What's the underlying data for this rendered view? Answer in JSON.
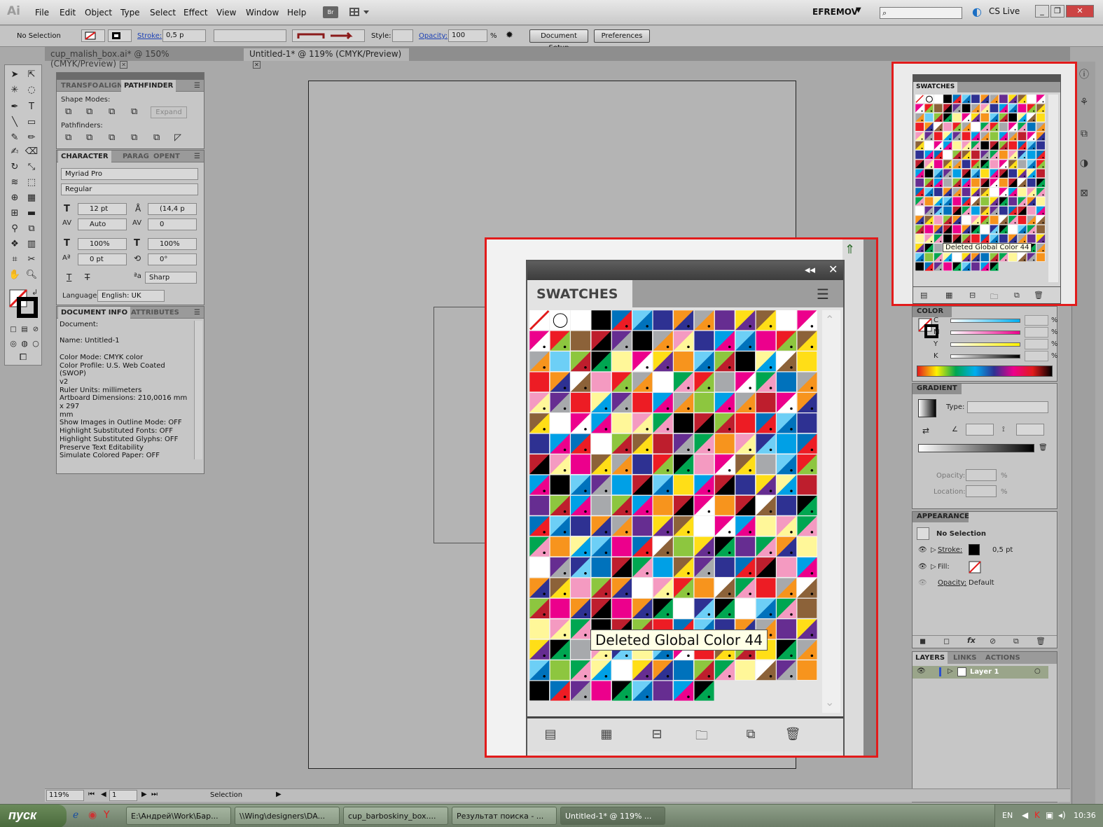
{
  "app": {
    "logo": "Ai",
    "menus": [
      "File",
      "Edit",
      "Object",
      "Type",
      "Select",
      "Effect",
      "View",
      "Window",
      "Help"
    ],
    "bridge_label": "Br",
    "user": "EFREMOV",
    "cs_live": "CS Live",
    "search_placeholder": ""
  },
  "control_bar": {
    "selection": "No Selection",
    "stroke_label": "Stroke:",
    "stroke_weight": "0,5 p",
    "style_label": "Style:",
    "opacity_label": "Opacity:",
    "opacity_value": "100",
    "opacity_unit": "%",
    "document_setup": "Document Setup",
    "preferences": "Preferences"
  },
  "doc_tabs": [
    {
      "label": "cup_malish_box.ai* @ 150% (CMYK/Preview)",
      "active": false
    },
    {
      "label": "Untitled-1* @ 119% (CMYK/Preview)",
      "active": true
    }
  ],
  "pathfinder": {
    "tabs": [
      "TRANSFO",
      "ALIGN",
      "PATHFINDER"
    ],
    "shape_modes": "Shape Modes:",
    "pathfinders": "Pathfinders:",
    "expand": "Expand"
  },
  "character": {
    "tabs": [
      "CHARACTER",
      "PARAG",
      "OPENT"
    ],
    "font": "Myriad Pro",
    "style": "Regular",
    "size": "12 pt",
    "leading": "(14,4 p",
    "kerning": "Auto",
    "tracking": "0",
    "v_scale": "100%",
    "h_scale": "100%",
    "baseline": "0 pt",
    "rotation": "0°",
    "anti_alias": "Sharp",
    "language_label": "Language:",
    "language": "English: UK"
  },
  "document_info": {
    "tabs": [
      "DOCUMENT INFO",
      "ATTRIBUTES"
    ],
    "lines": [
      "Document:",
      "",
      "Name: Untitled-1",
      "",
      "Color Mode: CMYK color",
      "Color Profile: U.S. Web Coated (SWOP)",
      "v2",
      "Ruler Units: millimeters",
      "Artboard Dimensions: 210,0016 mm x 297",
      "mm",
      "Show Images in Outline Mode: OFF",
      "Highlight Substituted Fonts: OFF",
      "Highlight Substituted Glyphs: OFF",
      "Preserve Text Editability",
      "Simulate Colored Paper: OFF"
    ]
  },
  "swatches": {
    "title": "SWATCHES",
    "tooltip": "Deleted Global Color 44",
    "palette": [
      "#000000",
      "#f7941d",
      "#00a0e6",
      "#ed1c24",
      "#ffde17",
      "#00a651",
      "#2e3192",
      "#ec008c",
      "#8dc63f",
      "#662d91",
      "#f49ac1",
      "#6dcff6",
      "#ffffff",
      "#be1e2d",
      "#a7a9ac",
      "#fff799",
      "#0072bc",
      "#8c6239"
    ]
  },
  "color_panel": {
    "title": "COLOR",
    "channels": [
      "C",
      "M",
      "Y",
      "K"
    ],
    "unit": "%"
  },
  "gradient_panel": {
    "title": "GRADIENT",
    "type_label": "Type:",
    "opacity_label": "Opacity:",
    "location_label": "Location:",
    "unit": "%"
  },
  "appearance_panel": {
    "title": "APPEARANCE",
    "selection": "No Selection",
    "stroke_label": "Stroke:",
    "stroke_value": "0,5 pt",
    "fill_label": "Fill:",
    "opacity_label": "Opacity:",
    "opacity_value": "Default"
  },
  "layers_panel": {
    "tabs": [
      "LAYERS",
      "LINKS",
      "ACTIONS"
    ],
    "layer": "Layer 1"
  },
  "status_bar": {
    "zoom": "119%",
    "page": "1",
    "mode": "Selection"
  },
  "taskbar": {
    "start": "пуск",
    "tasks": [
      "E:\\Андрей\\Work\\Бар...",
      "\\\\Wing\\designers\\DA...",
      "cup_barboskiny_box....",
      "Результат поиска - ...",
      "Untitled-1* @ 119% ..."
    ],
    "lang": "EN",
    "time": "10:36"
  },
  "colors": {
    "callout_border": "#e21b1b",
    "link_blue": "#1a3fb5"
  }
}
